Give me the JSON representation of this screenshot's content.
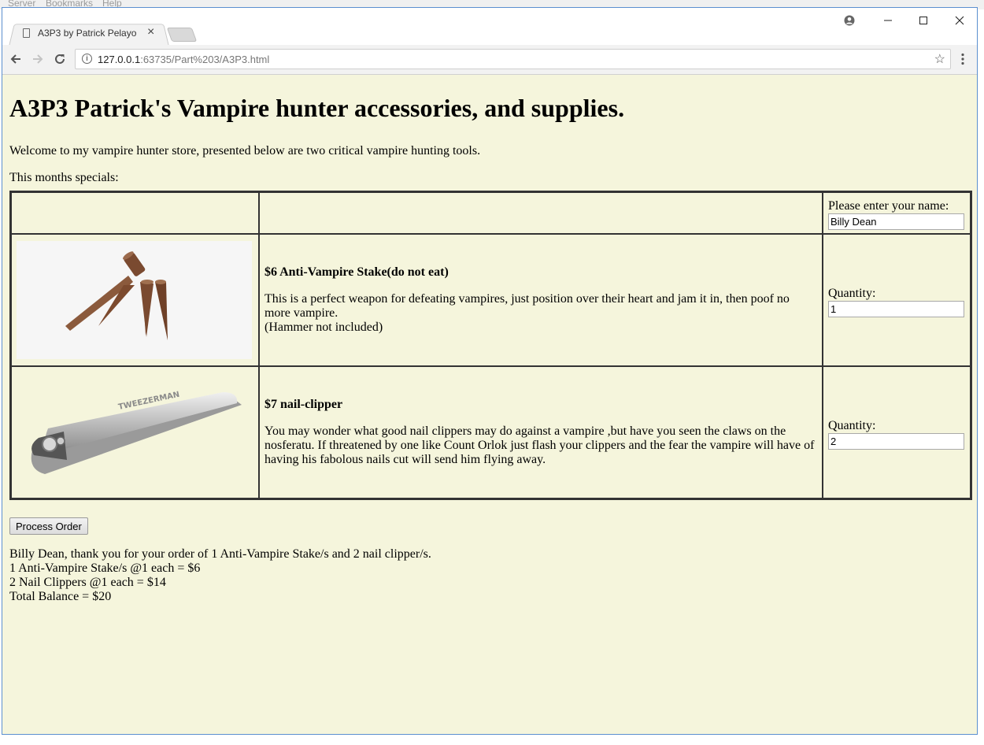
{
  "desktop": {
    "menu": [
      "Server",
      "Bookmarks",
      "Help"
    ]
  },
  "browser": {
    "tab_title": "A3P3 by Patrick Pelayo",
    "tab_close": "×",
    "url_host": "127.0.0.1",
    "url_path": ":63735/Part%203/A3P3.html",
    "window_controls": {
      "minimize": "—",
      "maximize": "☐",
      "close": "✕"
    }
  },
  "page": {
    "title": "A3P3 Patrick's Vampire hunter accessories, and supplies.",
    "welcome": "Welcome to my vampire hunter store, presented below are two critical vampire hunting tools.",
    "specials": "This months specials:",
    "name_label": "Please enter your name:",
    "name_value": "Billy Dean",
    "products": [
      {
        "title": "$6 Anti-Vampire Stake(do not eat)",
        "desc_line1": "This is a perfect weapon for defeating vampires, just position over their heart and jam it in, then poof no more vampire.",
        "desc_line2": "(Hammer not included)",
        "quantity_label": "Quantity:",
        "quantity_value": "1"
      },
      {
        "title": "$7 nail-clipper",
        "desc": "You may wonder what good nail clippers may do against a vampire ,but have you seen the claws on the nosferatu. If threatened by one like Count Orlok just flash your clippers and the fear the vampire will have of having his fabolous nails cut will send him flying away.",
        "quantity_label": "Quantity:",
        "quantity_value": "2",
        "brand": "TWEEZERMAN"
      }
    ],
    "process_button": "Process Order",
    "summary": [
      "Billy Dean, thank you for your order of 1 Anti-Vampire Stake/s and 2 nail clipper/s.",
      "1 Anti-Vampire Stake/s @1 each = $6",
      "2 Nail Clippers @1 each = $14",
      "Total Balance = $20"
    ]
  }
}
